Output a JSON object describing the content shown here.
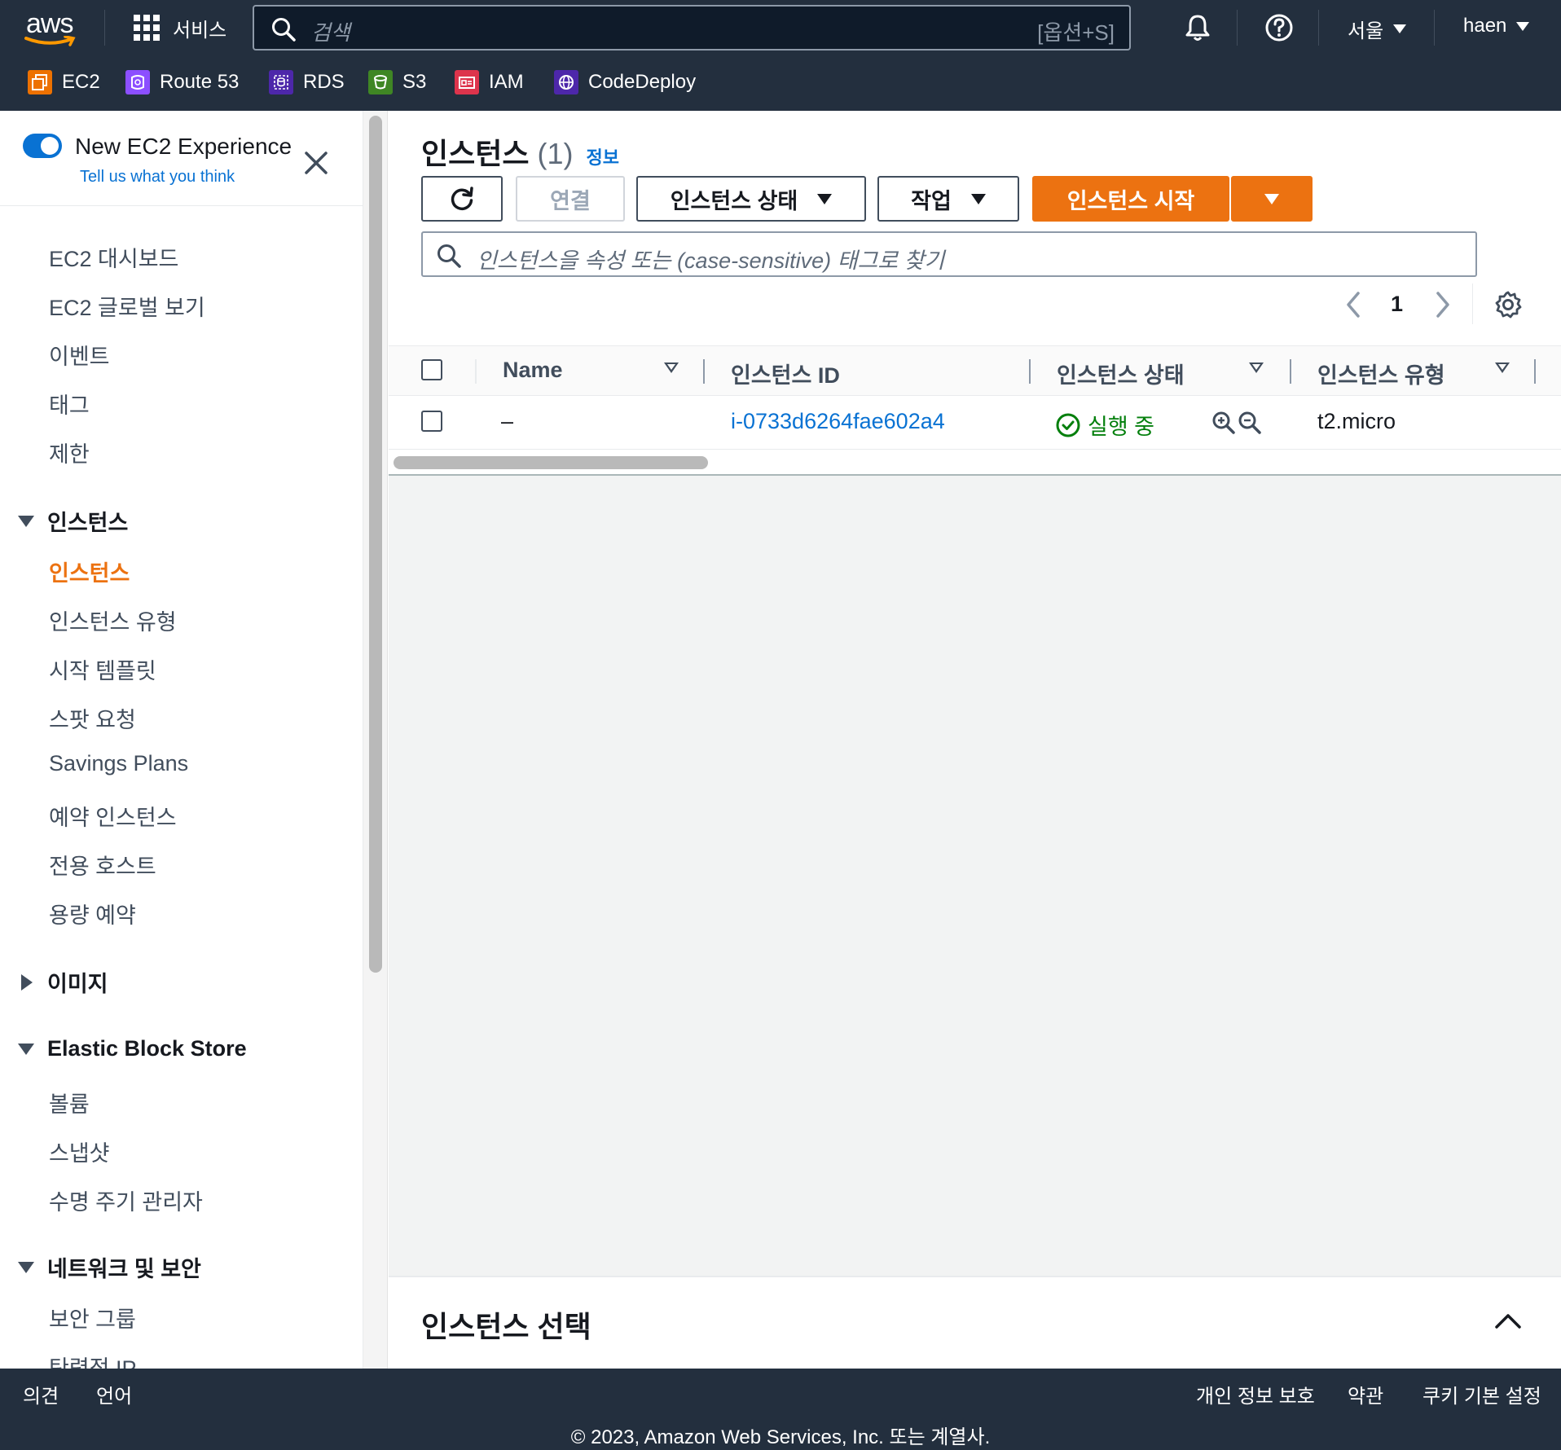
{
  "topnav": {
    "logo_text": "aws",
    "services_label": "서비스",
    "search_placeholder": "검색",
    "search_shortcut": "[옵션+S]",
    "region": "서울",
    "user": "haen",
    "favorites": [
      {
        "label": "EC2",
        "icon": "ec2-icon",
        "color": "#ed7100"
      },
      {
        "label": "Route 53",
        "icon": "route53-icon",
        "color": "#8c4fff"
      },
      {
        "label": "RDS",
        "icon": "rds-icon",
        "color": "#4d27aa"
      },
      {
        "label": "S3",
        "icon": "s3-icon",
        "color": "#3f8624"
      },
      {
        "label": "IAM",
        "icon": "iam-icon",
        "color": "#dd344c"
      },
      {
        "label": "CodeDeploy",
        "icon": "codedeploy-icon",
        "color": "#4d27aa"
      }
    ]
  },
  "sidebar": {
    "new_experience": "New EC2 Experience",
    "tell_us": "Tell us what you think",
    "top_items": [
      "EC2 대시보드",
      "EC2 글로벌 보기",
      "이벤트",
      "태그",
      "제한"
    ],
    "sections": [
      {
        "title": "인스턴스",
        "expanded": true,
        "items": [
          "인스턴스",
          "인스턴스 유형",
          "시작 템플릿",
          "스팟 요청",
          "Savings Plans",
          "예약 인스턴스",
          "전용 호스트",
          "용량 예약"
        ]
      },
      {
        "title": "이미지",
        "expanded": false,
        "items": []
      },
      {
        "title": "Elastic Block Store",
        "expanded": true,
        "items": [
          "볼륨",
          "스냅샷",
          "수명 주기 관리자"
        ]
      },
      {
        "title": "네트워크 및 보안",
        "expanded": true,
        "items": [
          "보안 그룹",
          "탄력적 IP"
        ]
      }
    ],
    "active_item": "인스턴스"
  },
  "main": {
    "title": "인스턴스",
    "count": "(1)",
    "info_link": "정보",
    "buttons": {
      "connect": "연결",
      "instance_state": "인스턴스 상태",
      "actions": "작업",
      "launch": "인스턴스 시작"
    },
    "filter_placeholder": "인스턴스을 속성 또는 (case-sensitive) 태그로 찾기",
    "page": "1",
    "columns": [
      "Name",
      "인스턴스 ID",
      "인스턴스 상태",
      "인스턴스 유형"
    ],
    "rows": [
      {
        "name": "–",
        "instance_id": "i-0733d6264fae602a4",
        "state": "실행 중",
        "type": "t2.micro"
      }
    ],
    "bottom_title": "인스턴스 선택"
  },
  "footer": {
    "feedback": "의견",
    "language": "언어",
    "privacy": "개인 정보 보호",
    "terms": "약관",
    "cookies": "쿠키 기본 설정",
    "copyright": "© 2023, Amazon Web Services, Inc. 또는 계열사."
  },
  "colors": {
    "nav_bg": "#232f3e",
    "accent": "#ec7211",
    "link": "#0972d3",
    "success": "#037f0c"
  }
}
